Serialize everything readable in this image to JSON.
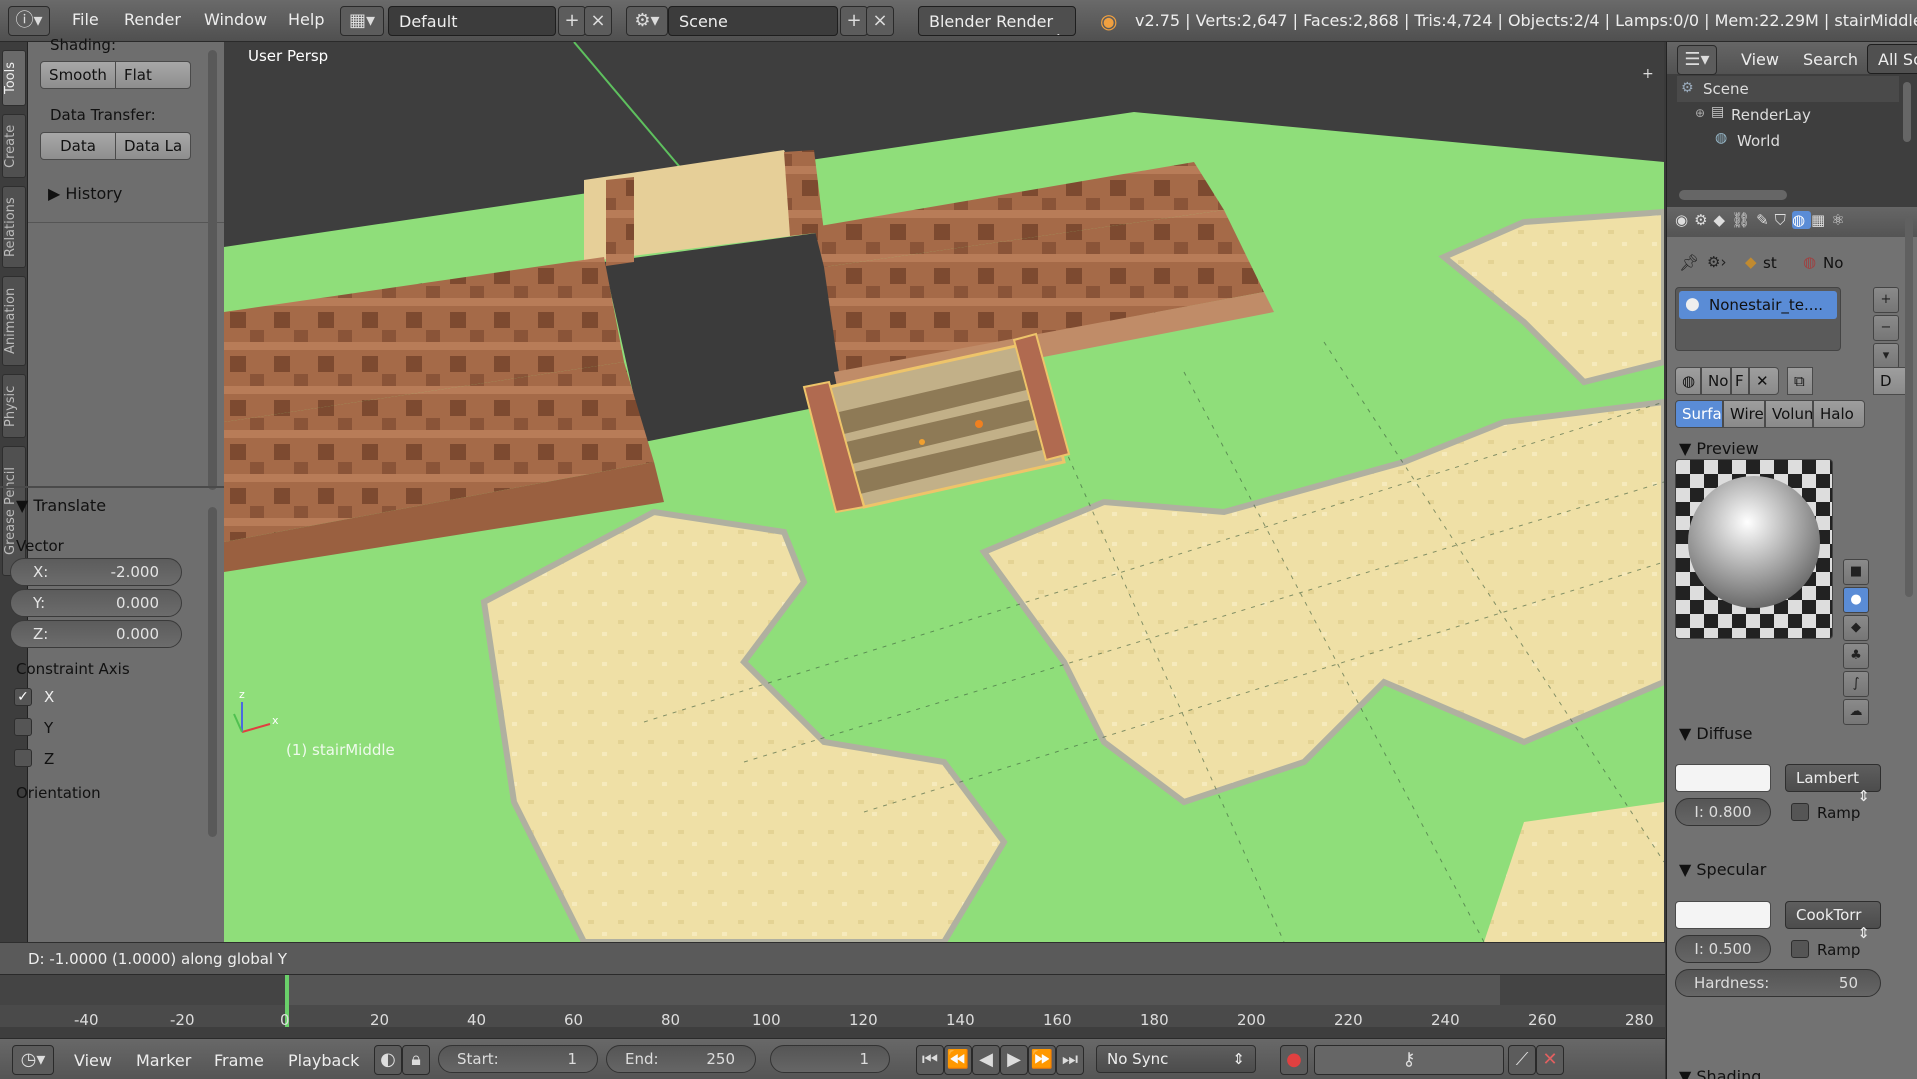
{
  "header": {
    "menus": [
      "File",
      "Render",
      "Window",
      "Help"
    ],
    "screen_layout": "Default",
    "scene": "Scene",
    "engine": "Blender Render",
    "stats": "v2.75 | Verts:2,647 | Faces:2,868 | Tris:4,724 | Objects:2/4 | Lamps:0/0 | Mem:22.29M | stairMiddle"
  },
  "tool_tabs": [
    "Tools",
    "Create",
    "Relations",
    "Animation",
    "Physic",
    "Grease Pencil"
  ],
  "tools": {
    "shading_label": "Shading:",
    "smooth": "Smooth",
    "flat": "Flat",
    "data_transfer_label": "Data Transfer:",
    "data": "Data",
    "data_layout": "Data La",
    "history": "History"
  },
  "operator": {
    "title": "Translate",
    "vector_label": "Vector",
    "x_label": "X:",
    "x_value": "-2.000",
    "y_label": "Y:",
    "y_value": "0.000",
    "z_label": "Z:",
    "z_value": "0.000",
    "constraint_label": "Constraint Axis",
    "axis_x": "X",
    "axis_y": "Y",
    "axis_z": "Z",
    "axis_x_checked": true,
    "orientation_label": "Orientation"
  },
  "viewport": {
    "view_name": "User Persp",
    "object_label": "(1) stairMiddle"
  },
  "status_text": "D: -1.0000 (1.0000) along global Y",
  "timeline": {
    "ticks": [
      "-40",
      "-20",
      "0",
      "20",
      "40",
      "60",
      "80",
      "100",
      "120",
      "140",
      "160",
      "180",
      "200",
      "220",
      "240",
      "260",
      "280"
    ],
    "current_frame": 0,
    "menus": [
      "View",
      "Marker",
      "Frame",
      "Playback"
    ],
    "start_label": "Start:",
    "start": "1",
    "end_label": "End:",
    "end": "250",
    "frame": "1",
    "sync": "No Sync"
  },
  "outliner": {
    "view": "View",
    "search": "Search",
    "filter": "All Sc",
    "items": [
      "Scene",
      "RenderLay",
      "World"
    ]
  },
  "properties": {
    "breadcrumb_obj": "st",
    "breadcrumb_mat": "No",
    "material_slot": "Nonestair_te....",
    "mat_name_short": "No",
    "mat_f": "F",
    "data_btn": "D",
    "tabs": [
      "Surfac",
      "Wire",
      "Volum",
      "Halo"
    ],
    "active_tab": "Surfac",
    "preview": "Preview",
    "diffuse": "Diffuse",
    "diffuse_shader": "Lambert",
    "diffuse_intensity": "I: 0.800",
    "ramp": "Ramp",
    "specular": "Specular",
    "specular_shader": "CookTorr",
    "specular_intensity": "I: 0.500",
    "hardness_label": "Hardness:",
    "hardness": "50",
    "shading": "Shading"
  },
  "colors": {
    "accent": "#5a8cd6",
    "grass": "#8fde7a",
    "sand": "#ecdca0",
    "brick": "#9a6040"
  }
}
